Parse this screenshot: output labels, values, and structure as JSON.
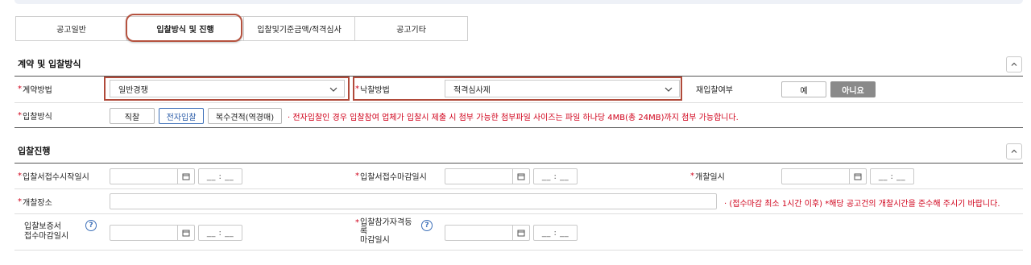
{
  "tabs": [
    {
      "label": "공고일반"
    },
    {
      "label": "입찰방식 및 진행"
    },
    {
      "label": "입찰및기준금액/적격심사"
    },
    {
      "label": "공고기타"
    }
  ],
  "section1": {
    "title": "계약 및 입찰방식",
    "contract_method_label": "계약방법",
    "contract_method_value": "일반경쟁",
    "award_method_label": "낙찰방법",
    "award_method_value": "적격심사제",
    "rebid_label": "재입찰여부",
    "rebid_yes": "예",
    "rebid_no": "아니요",
    "bid_method_label": "입찰방식",
    "bid_direct": "직찰",
    "bid_electronic": "전자입찰",
    "bid_multi_price": "복수견적(역경매)",
    "bid_notice": "· 전자입찰인 경우 입찰참여 업체가 입찰시 제출 시 첨부 가능한 첨부파일 사이즈는 파일 하나당 4MB(총 24MB)까지 첨부 가능합니다."
  },
  "section2": {
    "title": "입찰진행",
    "submit_start_label": "입찰서접수시작일시",
    "submit_deadline_label": "입찰서접수마감일시",
    "opening_datetime_label": "개찰일시",
    "opening_place_label": "개찰장소",
    "opening_notice": "· (접수마감 최소 1시간 이후) *해당 공고건의 개찰시간을 준수해 주시기 바랍니다.",
    "bond_line1": "입찰보증서",
    "bond_line2": "접수마감일시",
    "qual_line1": "입찰참가자격등",
    "qual_line2": "록",
    "qual_line3": "마감일시",
    "time_placeholder": "__ : __",
    "help_symbol": "?"
  }
}
